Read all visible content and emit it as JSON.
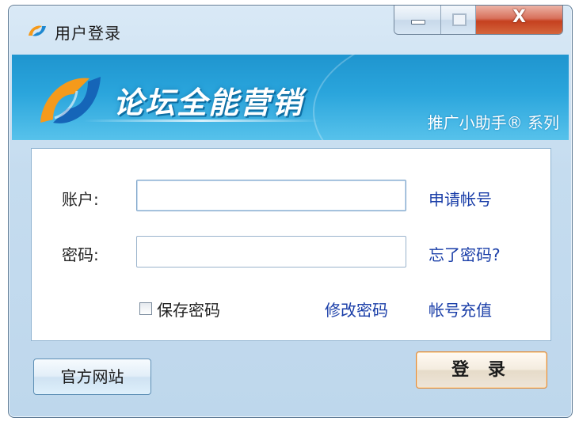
{
  "window": {
    "title": "用户登录",
    "close_glyph": "X"
  },
  "banner": {
    "product_name": "论坛全能营销",
    "tagline": "推广小助手® 系列"
  },
  "form": {
    "account_label": "账户:",
    "account_value": "",
    "password_label": "密码:",
    "password_value": "",
    "apply_account_link": "申请帐号",
    "forgot_password_link": "忘了密码?",
    "save_password_label": "保存密码",
    "save_password_checked": false,
    "change_password_link": "修改密码",
    "recharge_link": "帐号充值"
  },
  "buttons": {
    "website_label": "官方网站",
    "login_label": "登 录"
  },
  "icons": {
    "app": "app-logo-icon",
    "banner_logo": "product-logo-icon",
    "minimize": "minimize-icon",
    "maximize": "maximize-icon",
    "close": "close-icon"
  },
  "colors": {
    "banner_blue": "#2aa5dc",
    "link_blue": "#1a3ea8",
    "login_border": "#e08a3c",
    "close_red": "#c5401f",
    "logo_orange": "#f59a1b"
  }
}
